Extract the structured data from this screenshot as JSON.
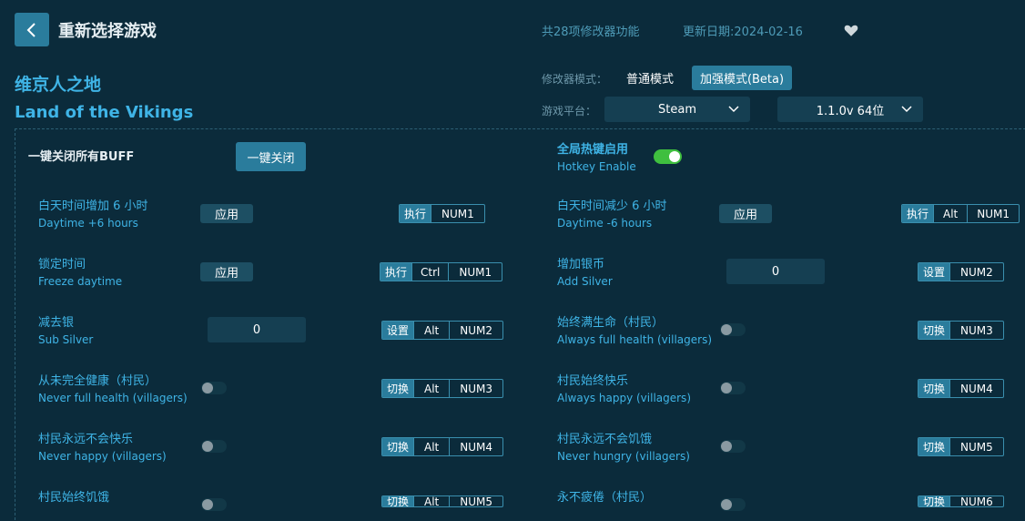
{
  "header": {
    "title": "重新选择游戏",
    "feature_count": "共28项修改器功能",
    "update_date": "更新日期:2024-02-16"
  },
  "game": {
    "name_cn": "维京人之地",
    "name_en": "Land of the Vikings"
  },
  "mode": {
    "label": "修改器模式：",
    "normal": "普通模式",
    "enhanced": "加强模式(Beta)"
  },
  "platform": {
    "label": "游戏平台：",
    "selected": "Steam",
    "version": "1.1.0v 64位"
  },
  "global": {
    "close_all_label": "一键关闭所有BUFF",
    "close_all_button": "一键关闭",
    "hotkey_cn": "全局热键启用",
    "hotkey_en": "Hotkey Enable"
  },
  "left": [
    {
      "cn": "白天时间增加 6 小时",
      "en": "Daytime +6 hours",
      "control": "应用",
      "keys": [
        "执行",
        "NUM1"
      ]
    },
    {
      "cn": "锁定时间",
      "en": "Freeze daytime",
      "control": "应用",
      "keys": [
        "执行",
        "Ctrl",
        "NUM1"
      ]
    },
    {
      "cn": "减去银",
      "en": "Sub Silver",
      "control": "0",
      "keys": [
        "设置",
        "Alt",
        "NUM2"
      ]
    },
    {
      "cn": "从未完全健康（村民）",
      "en": "Never full health (villagers)",
      "keys": [
        "切换",
        "Alt",
        "NUM3"
      ]
    },
    {
      "cn": "村民永远不会快乐",
      "en": "Never happy (villagers)",
      "keys": [
        "切换",
        "Alt",
        "NUM4"
      ]
    },
    {
      "cn": "村民始终饥饿",
      "en": "",
      "keys": [
        "切换",
        "Alt",
        "NUM5"
      ]
    }
  ],
  "right": [
    {
      "cn": "白天时间减少 6 小时",
      "en": "Daytime -6 hours",
      "control": "应用",
      "keys": [
        "执行",
        "Alt",
        "NUM1"
      ]
    },
    {
      "cn": "增加银币",
      "en": "Add Silver",
      "control": "0",
      "keys": [
        "设置",
        "NUM2"
      ]
    },
    {
      "cn": "始终满生命（村民）",
      "en": "Always full health (villagers)",
      "keys": [
        "切换",
        "NUM3"
      ]
    },
    {
      "cn": "村民始终快乐",
      "en": "Always happy (villagers)",
      "keys": [
        "切换",
        "NUM4"
      ]
    },
    {
      "cn": "村民永远不会饥饿",
      "en": "Never hungry (villagers)",
      "keys": [
        "切换",
        "NUM5"
      ]
    },
    {
      "cn": "永不疲倦（村民）",
      "en": "",
      "keys": [
        "切换",
        "NUM6"
      ]
    }
  ]
}
